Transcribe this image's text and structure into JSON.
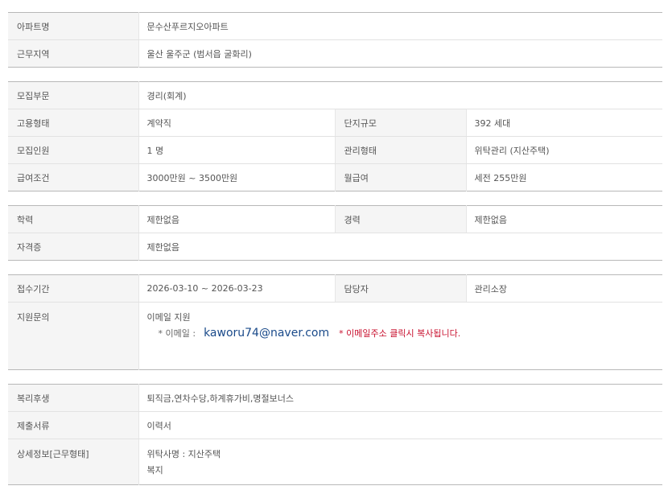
{
  "section1": {
    "apt_name_label": "아파트명",
    "apt_name_value": "문수산푸르지오아파트",
    "work_area_label": "근무지역",
    "work_area_value": "울산  울주군 (범서읍 굴화리)"
  },
  "section2": {
    "dept_label": "모집부문",
    "dept_value": "경리(회계)",
    "employ_label": "고용형태",
    "employ_value": "계약직",
    "complex_label": "단지규모",
    "complex_value": "392 세대",
    "headcount_label": "모집인원",
    "headcount_value": "1 명",
    "mgmt_label": "관리형태",
    "mgmt_value": "위탁관리 (지산주택)",
    "salary_label": "급여조건",
    "salary_value": "3000만원 ~ 3500만원",
    "monthly_label": "월급여",
    "monthly_value": "세전 255만원"
  },
  "section3": {
    "edu_label": "학력",
    "edu_value": "제한없음",
    "career_label": "경력",
    "career_value": "제한없음",
    "cert_label": "자격증",
    "cert_value": "제한없음"
  },
  "section4": {
    "period_label": "접수기간",
    "period_value": "2026-03-10 ~ 2026-03-23",
    "contact_label": "담당자",
    "contact_value": "관리소장",
    "inquiry_label": "지원문의",
    "inquiry_value": "이메일 지원",
    "email_prefix": "* 이메일   :",
    "email": "kaworu74@naver.com",
    "email_note": "* 이메일주소 클릭시 복사됩니다."
  },
  "section5": {
    "welfare_label": "복리후생",
    "welfare_value": "퇴직금,연차수당,하계휴가비,명절보너스",
    "docs_label": "제출서류",
    "docs_value": "이력서",
    "detail_label": "상세정보[근무형태]",
    "detail_line1": "위탁사명 : 지산주택",
    "detail_line2": "복지"
  }
}
